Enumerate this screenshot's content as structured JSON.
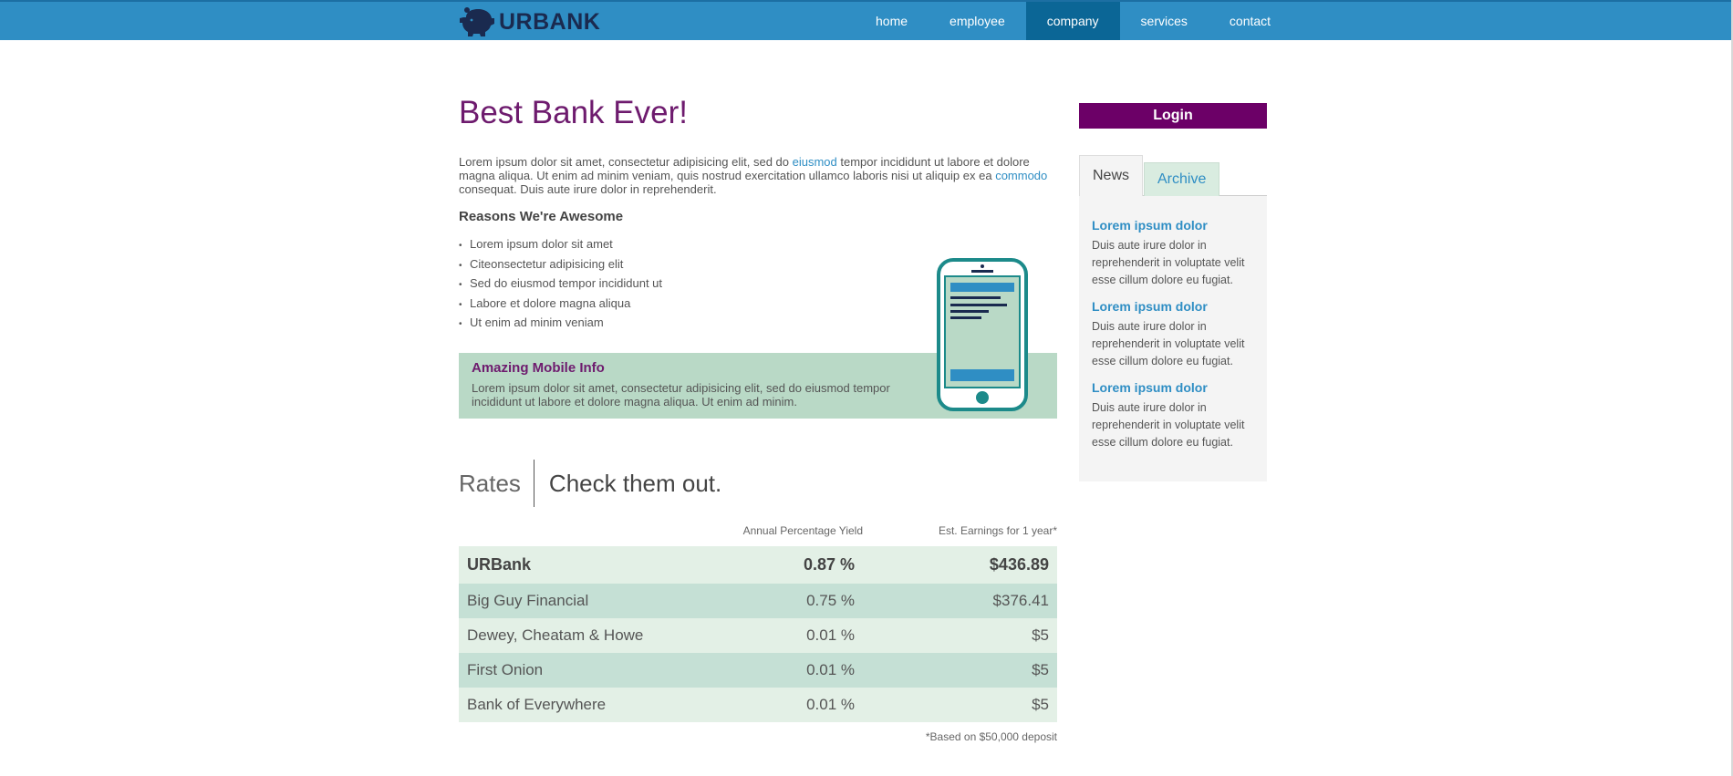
{
  "brand": {
    "name": "URBANK"
  },
  "nav": {
    "items": [
      {
        "label": "home"
      },
      {
        "label": "employee"
      },
      {
        "label": "company",
        "active": true
      },
      {
        "label": "services"
      },
      {
        "label": "contact"
      }
    ]
  },
  "main": {
    "title": "Best Bank Ever!",
    "intro": {
      "part1": "Lorem ipsum dolor sit amet, consectetur adipisicing elit, sed do ",
      "link1": "eiusmod",
      "part2": " tempor incididunt ut labore et dolore magna aliqua. Ut enim ad minim veniam, quis nostrud exercitation ullamco laboris nisi ut aliquip ex ea ",
      "link2": "commodo",
      "part3": " consequat. Duis aute irure dolor in reprehenderit."
    },
    "reasons_heading": "Reasons We're Awesome",
    "reasons": [
      "Lorem ipsum dolor sit amet",
      "Citeonsectetur adipisicing elit",
      "Sed do eiusmod tempor incididunt ut",
      "Labore et dolore magna aliqua",
      "Ut enim ad minim veniam"
    ],
    "mobile": {
      "heading": "Amazing Mobile Info",
      "text": "Lorem ipsum dolor sit amet, consectetur adipisicing elit, sed do eiusmod tempor incididunt ut labore et dolore magna aliqua. Ut enim ad minim."
    }
  },
  "rates": {
    "label": "Rates",
    "tagline": "Check them out.",
    "col_apy": "Annual Percentage Yield",
    "col_earnings": "Est. Earnings for 1 year*",
    "rows": [
      {
        "bank": "URBank",
        "apy": "0.87 %",
        "earnings": "$436.89"
      },
      {
        "bank": "Big Guy Financial",
        "apy": "0.75 %",
        "earnings": "$376.41"
      },
      {
        "bank": "Dewey, Cheatam & Howe",
        "apy": "0.01 %",
        "earnings": "$5"
      },
      {
        "bank": "First Onion",
        "apy": "0.01 %",
        "earnings": "$5"
      },
      {
        "bank": "Bank of Everywhere",
        "apy": "0.01 %",
        "earnings": "$5"
      }
    ],
    "footnote": "*Based on $50,000 deposit"
  },
  "sidebar": {
    "login_label": "Login",
    "tabs": [
      {
        "label": "News",
        "active": true
      },
      {
        "label": "Archive"
      }
    ],
    "news": [
      {
        "title": "Lorem ipsum dolor",
        "body": "Duis aute irure dolor in reprehenderit in voluptate velit esse cillum dolore eu fugiat."
      },
      {
        "title": "Lorem ipsum dolor",
        "body": "Duis aute irure dolor in reprehenderit in voluptate velit esse cillum dolore eu fugiat."
      },
      {
        "title": "Lorem ipsum dolor",
        "body": "Duis aute irure dolor in reprehenderit in voluptate velit esse cillum dolore eu fugiat."
      }
    ]
  },
  "colors": {
    "nav_bg": "#2f8ec4",
    "nav_active": "#0b6696",
    "title_purple": "#6e1b6e",
    "login_bg": "#6c0067",
    "mobile_bg": "#b9d9c6",
    "phone_teal": "#1c8a8a"
  },
  "icons": {
    "logo": "piggy-bank-icon",
    "phone": "mobile-phone-icon"
  }
}
